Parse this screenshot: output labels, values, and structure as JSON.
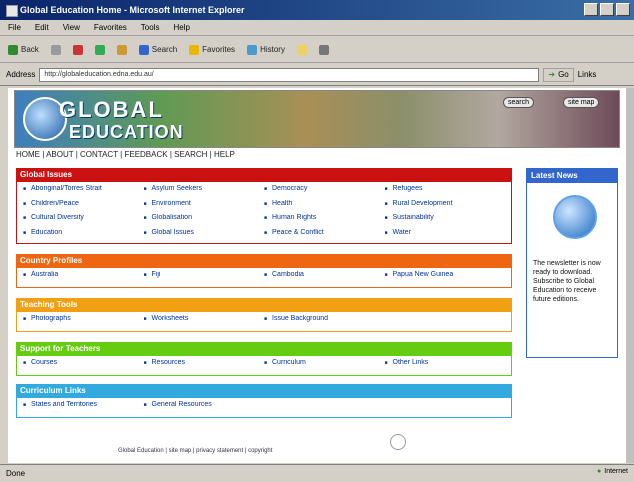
{
  "window": {
    "title": "Global Education Home - Microsoft Internet Explorer"
  },
  "menu": [
    "File",
    "Edit",
    "View",
    "Favorites",
    "Tools",
    "Help"
  ],
  "toolbar": [
    {
      "label": "Back",
      "icon": "back-icon"
    },
    {
      "label": "",
      "icon": "forward-icon"
    },
    {
      "label": "",
      "icon": "stop-icon"
    },
    {
      "label": "",
      "icon": "refresh-icon"
    },
    {
      "label": "",
      "icon": "home-icon"
    },
    {
      "label": "Search",
      "icon": "search-icon"
    },
    {
      "label": "Favorites",
      "icon": "favorites-icon"
    },
    {
      "label": "History",
      "icon": "history-icon"
    },
    {
      "label": "",
      "icon": "mail-icon"
    },
    {
      "label": "",
      "icon": "print-icon"
    }
  ],
  "address": {
    "label": "Address",
    "url": "http://globaleducation.edna.edu.au/",
    "go": "Go",
    "links": "Links"
  },
  "site": {
    "logo_line1": "GLOBAL",
    "logo_line2": "EDUCATION",
    "banner_buttons": [
      "search",
      "site map"
    ],
    "topnav": "HOME | ABOUT | CONTACT | FEEDBACK | SEARCH | HELP"
  },
  "sections": [
    {
      "title": "Global Issues",
      "color": "#cc1111",
      "links": [
        "Aboriginal/Torres Strait",
        "Asylum Seekers",
        "Democracy",
        "Refugees",
        "Children/Peace",
        "Environment",
        "Health",
        "Rural Development",
        "Cultural Diversity",
        "Globalisation",
        "Human Rights",
        "Sustainability",
        "Education",
        "Global Issues",
        "Peace & Conflict",
        "Water"
      ]
    },
    {
      "title": "Country Profiles",
      "color": "#ee6611",
      "links": [
        "Australia",
        "Fiji",
        "Cambodia",
        "Papua New Guinea"
      ]
    },
    {
      "title": "Teaching Tools",
      "color": "#f0a012",
      "links": [
        "Photographs",
        "Worksheets",
        "Issue Background"
      ]
    },
    {
      "title": "Support for Teachers",
      "color": "#66cc11",
      "links": [
        "Courses",
        "Resources",
        "Curriculum",
        "Other Links"
      ]
    },
    {
      "title": "Curriculum Links",
      "color": "#33aadd",
      "links": [
        "States and Territories",
        "General Resources"
      ]
    }
  ],
  "sidebar": {
    "title": "Latest News",
    "text": "The newsletter is now ready to download. Subscribe to Global Education to receive future editions."
  },
  "footer": "Global Education | site map | privacy statement | copyright",
  "status": {
    "left": "Done",
    "zone": "Internet"
  }
}
